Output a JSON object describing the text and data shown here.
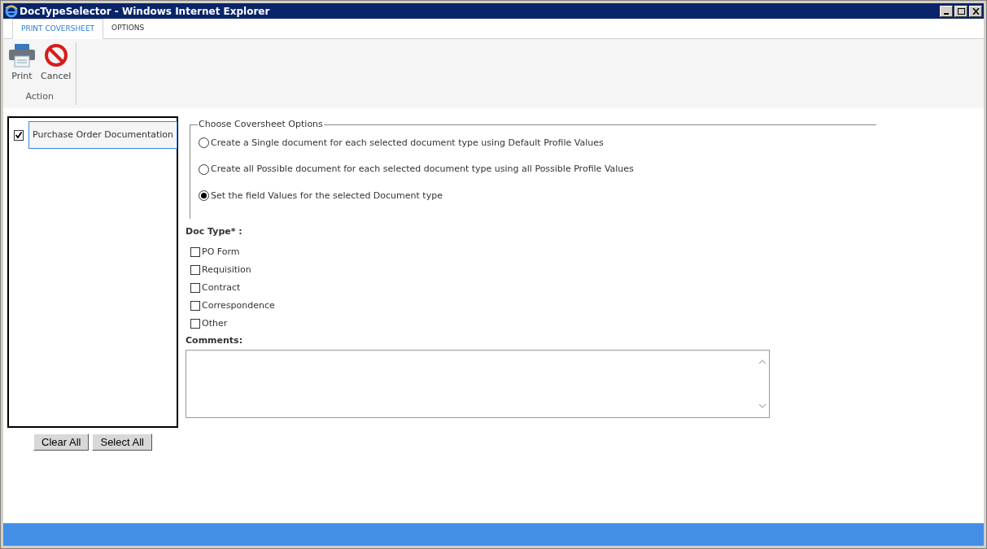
{
  "window": {
    "title": "DocTypeSelector - Windows Internet Explorer"
  },
  "tabs": [
    {
      "label": "PRINT COVERSHEET",
      "selected": true
    },
    {
      "label": "OPTIONS",
      "selected": false
    }
  ],
  "ribbon": {
    "group": "Action",
    "buttons": [
      {
        "kind": "print",
        "label": "Print"
      },
      {
        "kind": "cancel",
        "label": "Cancel"
      }
    ]
  },
  "doc_list": {
    "items": [
      {
        "label": "Purchase Order Documentation",
        "checked": true
      }
    ],
    "buttons": [
      "Clear All",
      "Select All"
    ]
  },
  "coversheet_options": {
    "legend": "Choose Coversheet Options",
    "options": [
      {
        "label": "Create a Single document for each selected document type using Default Profile Values",
        "selected": false
      },
      {
        "label": "Create all Possible document for each selected document type using all Possible Profile Values",
        "selected": false
      },
      {
        "label": "Set the field Values for the selected Document type",
        "selected": true
      }
    ]
  },
  "doc_type": {
    "label": "Doc Type* :",
    "items": [
      {
        "label": "PO Form",
        "checked": false
      },
      {
        "label": "Requisition",
        "checked": false
      },
      {
        "label": "Contract",
        "checked": false
      },
      {
        "label": "Correspondence",
        "checked": false
      },
      {
        "label": "Other",
        "checked": false
      }
    ]
  },
  "comments": {
    "label": "Comments:"
  }
}
